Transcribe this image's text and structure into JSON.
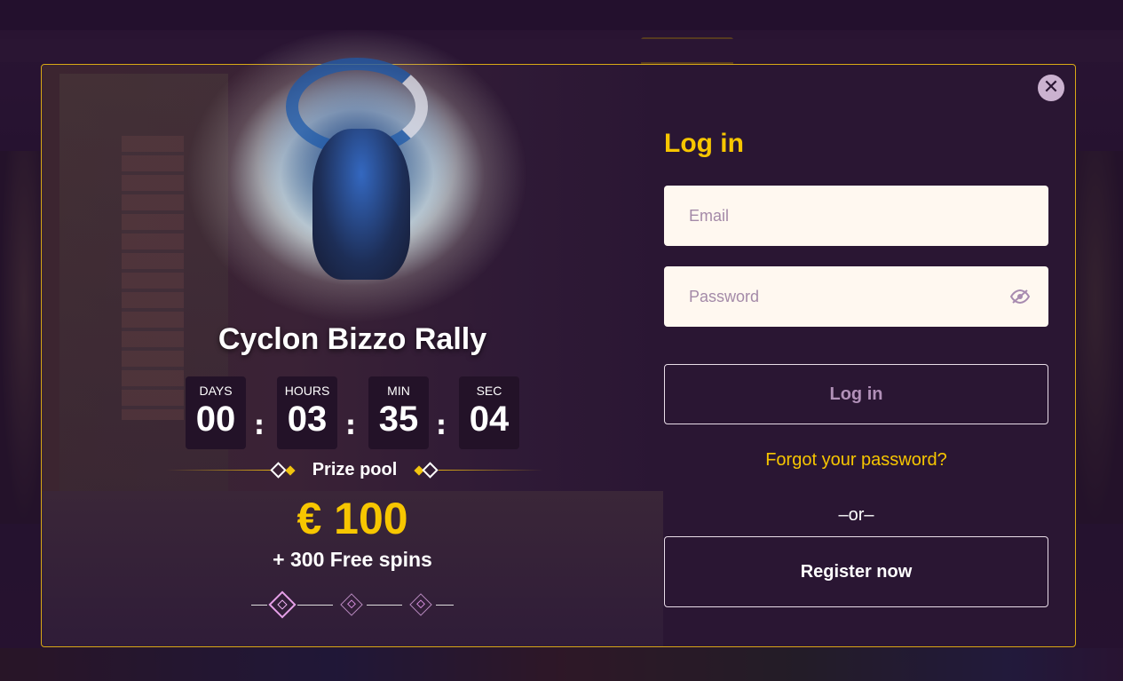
{
  "promo": {
    "title": "Cyclon Bizzo Rally",
    "countdown": [
      {
        "label": "DAYS",
        "value": "00"
      },
      {
        "label": "HOURS",
        "value": "03"
      },
      {
        "label": "MIN",
        "value": "35"
      },
      {
        "label": "SEC",
        "value": "04"
      }
    ],
    "separator": ":",
    "prize_label": "Prize pool",
    "prize_amount": "€ 100",
    "prize_extra": "+ 300 Free spins",
    "slides": {
      "count": 3,
      "active": 1
    }
  },
  "login": {
    "title": "Log in",
    "email_placeholder": "Email",
    "password_placeholder": "Password",
    "login_button": "Log in",
    "forgot_link": "Forgot your password?",
    "divider": "–or–",
    "register_button": "Register now"
  },
  "icons": {
    "close": "close-icon",
    "password_toggle": "eye-slash-icon"
  },
  "colors": {
    "accent_yellow": "#f7c600",
    "modal_border": "#d9a915",
    "background": "#2a1633",
    "field_bg": "#fff8f0"
  }
}
